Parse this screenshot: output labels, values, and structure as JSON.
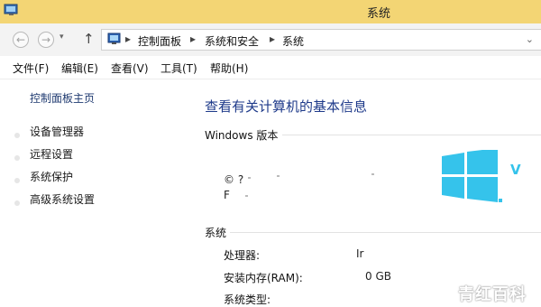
{
  "window": {
    "title": "系统"
  },
  "navigation": {
    "back_icon": "arrow-left-icon",
    "forward_icon": "arrow-right-icon",
    "up_icon": "arrow-up-icon",
    "breadcrumb": [
      "控制面板",
      "系统和安全",
      "系统"
    ],
    "separator": "▸",
    "dropdown_glyph": "⌄"
  },
  "menu": {
    "items": [
      "文件(F)",
      "编辑(E)",
      "查看(V)",
      "工具(T)",
      "帮助(H)"
    ]
  },
  "sidebar": {
    "home_link": "控制面板主页",
    "items": [
      "设备管理器",
      "远程设置",
      "系统保护",
      "高级系统设置"
    ]
  },
  "main": {
    "heading": "查看有关计算机的基本信息",
    "edition": {
      "title": "Windows 版本",
      "line1": "© ?",
      "line2": "F"
    },
    "system": {
      "title": "系统",
      "rows": [
        {
          "label": "处理器:",
          "value": "Ir"
        },
        {
          "label": "安装内存(RAM):",
          "value": "0 GB"
        },
        {
          "label": "系统类型:",
          "value": ""
        }
      ]
    },
    "logo_letter": "V"
  },
  "colors": {
    "titlebar": "#f3d574",
    "heading": "#1e3a8a",
    "windows_logo": "#35c3eb"
  },
  "watermark": "青红百科"
}
